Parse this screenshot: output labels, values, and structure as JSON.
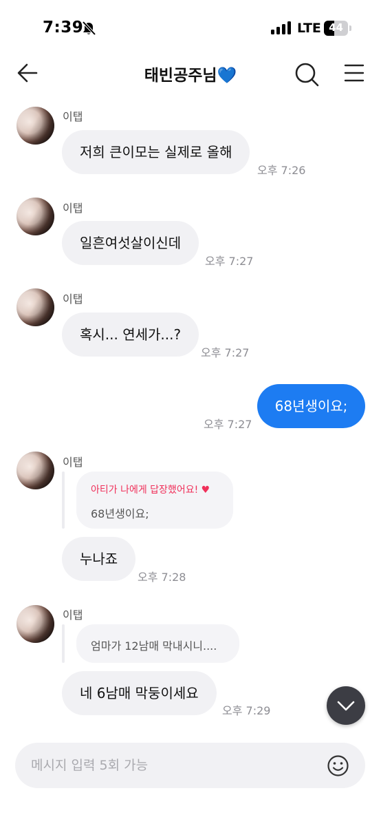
{
  "status_bar": {
    "time": "7:39",
    "network": "LTE",
    "battery": "44",
    "battery_level": 0.44,
    "icons": [
      "bell-slash-icon",
      "signal-icon",
      "battery-icon"
    ]
  },
  "header": {
    "title": "태빈공주님",
    "title_emoji": "💙",
    "icons": [
      "back-arrow-icon",
      "search-icon",
      "menu-icon"
    ]
  },
  "colors": {
    "outgoing_bubble": "#1d7cf2",
    "incoming_bubble": "#f1f1f4",
    "reply_highlight": "#f0305a",
    "timestamp": "#8d8d93",
    "scroll_button": "#3c3d44"
  },
  "messages": [
    {
      "sender": "이탭",
      "text": "저희 큰이모는 실제로 올해",
      "time": "오후 7:26"
    },
    {
      "sender": "이탭",
      "text": "일흔여섯살이신데",
      "time": "오후 7:27"
    },
    {
      "sender": "이탭",
      "text": "혹시... 연세가...?",
      "time": "오후 7:27"
    },
    {
      "text": "68년생이요;",
      "time": "오후 7:27"
    },
    {
      "sender": "이탭",
      "reply": {
        "header": "아티가 나에게 답장했어요!",
        "heart": "♥",
        "text": "68년생이요;"
      },
      "text": "누나죠",
      "time": "오후 7:28"
    },
    {
      "sender": "이탭",
      "reply": {
        "text": "엄마가 12남매 막내시니...."
      },
      "text": "네 6남매 막둥이세요",
      "time": "오후 7:29"
    }
  ],
  "input": {
    "placeholder": "메시지 입력 5회 가능",
    "value": ""
  }
}
